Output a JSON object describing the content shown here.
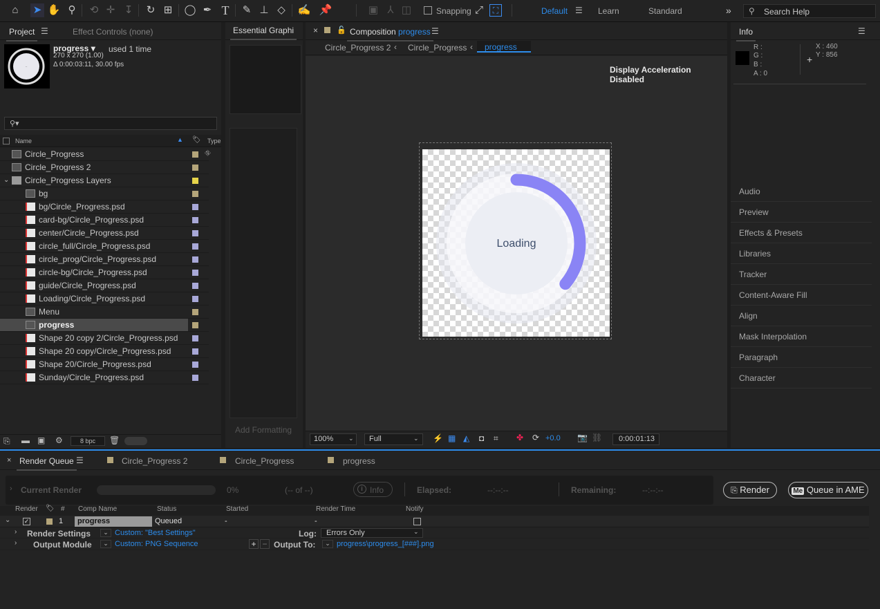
{
  "toolbar": {
    "snapping_label": "Snapping",
    "workspaces": [
      "Default",
      "Learn",
      "Standard"
    ],
    "search_placeholder": "Search Help"
  },
  "project_panel": {
    "tab_project": "Project",
    "tab_effect_controls": "Effect Controls (none)",
    "item_name": "progress",
    "usage": "used 1 time",
    "dims": "270 x 270 (1.00)",
    "duration": "Δ 0:00:03:11, 30.00 fps",
    "col_name": "Name",
    "col_type": "Type",
    "items": [
      {
        "name": "Circle_Progress",
        "type": "comp",
        "indent": 0,
        "label_color": "#b4a57a"
      },
      {
        "name": "Circle_Progress 2",
        "type": "comp",
        "indent": 0,
        "label_color": "#b4a57a"
      },
      {
        "name": "Circle_Progress Layers",
        "type": "folder",
        "indent": 0,
        "label_color": "#e6d44a"
      },
      {
        "name": "bg",
        "type": "comp",
        "indent": 1,
        "label_color": "#b4a57a"
      },
      {
        "name": "bg/Circle_Progress.psd",
        "type": "psd",
        "indent": 1,
        "label_color": "#a8a8d8"
      },
      {
        "name": "card-bg/Circle_Progress.psd",
        "type": "psd",
        "indent": 1,
        "label_color": "#a8a8d8"
      },
      {
        "name": "center/Circle_Progress.psd",
        "type": "psd",
        "indent": 1,
        "label_color": "#a8a8d8"
      },
      {
        "name": "circle_full/Circle_Progress.psd",
        "type": "psd",
        "indent": 1,
        "label_color": "#a8a8d8"
      },
      {
        "name": "circle_prog/Circle_Progress.psd",
        "type": "psd",
        "indent": 1,
        "label_color": "#a8a8d8"
      },
      {
        "name": "circle-bg/Circle_Progress.psd",
        "type": "psd",
        "indent": 1,
        "label_color": "#a8a8d8"
      },
      {
        "name": "guide/Circle_Progress.psd",
        "type": "psd",
        "indent": 1,
        "label_color": "#a8a8d8"
      },
      {
        "name": "Loading/Circle_Progress.psd",
        "type": "psd",
        "indent": 1,
        "label_color": "#a8a8d8"
      },
      {
        "name": "Menu",
        "type": "comp",
        "indent": 1,
        "label_color": "#b4a57a"
      },
      {
        "name": "progress",
        "type": "comp",
        "indent": 1,
        "label_color": "#b4a57a",
        "selected": true
      },
      {
        "name": "Shape 20 copy 2/Circle_Progress.psd",
        "type": "psd",
        "indent": 1,
        "label_color": "#a8a8d8"
      },
      {
        "name": "Shape 20 copy/Circle_Progress.psd",
        "type": "psd",
        "indent": 1,
        "label_color": "#a8a8d8"
      },
      {
        "name": "Shape 20/Circle_Progress.psd",
        "type": "psd",
        "indent": 1,
        "label_color": "#a8a8d8"
      },
      {
        "name": "Sunday/Circle_Progress.psd",
        "type": "psd",
        "indent": 1,
        "label_color": "#a8a8d8"
      }
    ],
    "bpc": "8 bpc"
  },
  "essential_graphics": {
    "tab": "Essential Graphi",
    "add_formatting": "Add Formatting"
  },
  "composition": {
    "tab_prefix": "Composition",
    "tab_name": "progress",
    "breadcrumbs": [
      "Circle_Progress 2",
      "Circle_Progress",
      "progress"
    ],
    "notice": "Display Acceleration Disabled",
    "canvas_text": "Loading",
    "progress_fraction": 0.36,
    "progress_color": "#8a84f5",
    "zoom": "100%",
    "resolution": "Full",
    "exposure": "+0.0",
    "timecode": "0:00:01:13"
  },
  "info_panel": {
    "tab": "Info",
    "r": "R :",
    "g": "G :",
    "b": "B :",
    "a": "A :  0",
    "x": "X : 460",
    "y": "Y : 856"
  },
  "right_panels": [
    "Audio",
    "Preview",
    "Effects & Presets",
    "Libraries",
    "Tracker",
    "Content-Aware Fill",
    "Align",
    "Mask Interpolation",
    "Paragraph",
    "Character"
  ],
  "render_queue": {
    "tab": "Render Queue",
    "other_tabs": [
      "Circle_Progress 2",
      "Circle_Progress",
      "progress"
    ],
    "current_render": "Current Render",
    "percent": "0%",
    "of": "(-- of --)",
    "info": "Info",
    "elapsed": "Elapsed:",
    "elapsed_val": "--:--:--",
    "remaining": "Remaining:",
    "remaining_val": "--:--:--",
    "render_button": "Render",
    "queue_ame": "Queue in AME",
    "columns": [
      "Render",
      "#",
      "Comp Name",
      "Status",
      "Started",
      "Render Time",
      "Notify"
    ],
    "item": {
      "num": "1",
      "comp": "progress",
      "status": "Queued",
      "started": "-",
      "render_time": "-"
    },
    "render_settings_label": "Render Settings",
    "render_settings_value": "Custom: \"Best Settings\"",
    "log_label": "Log:",
    "log_value": "Errors Only",
    "output_module_label": "Output Module",
    "output_module_value": "Custom: PNG Sequence",
    "output_to_label": "Output To:",
    "output_to_value": "progress\\progress_[###].png"
  }
}
